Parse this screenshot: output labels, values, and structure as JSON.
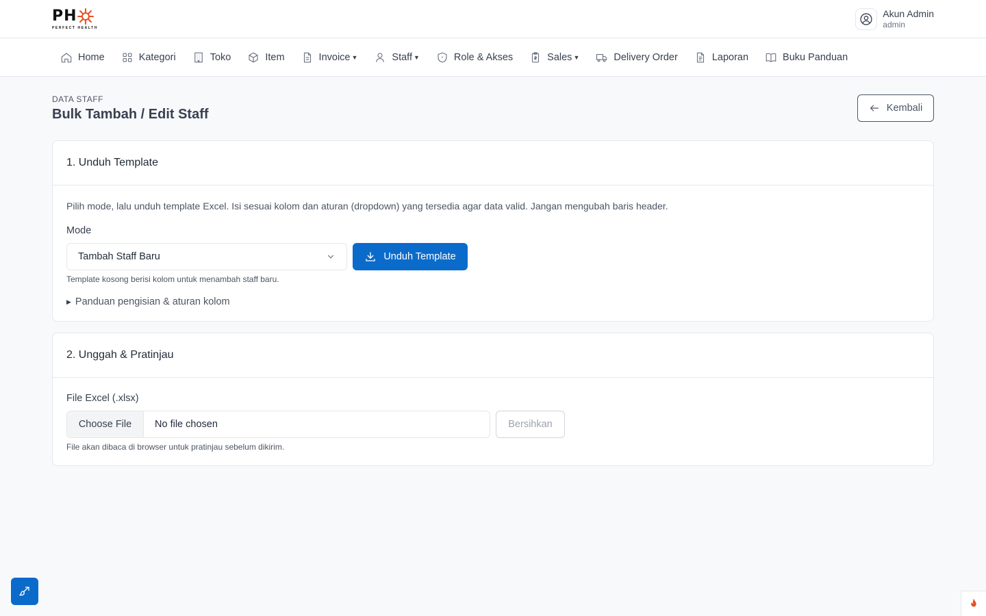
{
  "brand": {
    "logo_text": "PH",
    "tagline": "PERFECT HEALTH",
    "accent": "#e8501f"
  },
  "account": {
    "name": "Akun Admin",
    "role": "admin"
  },
  "nav": [
    {
      "label": "Home",
      "icon": "home-icon"
    },
    {
      "label": "Kategori",
      "icon": "grid-icon"
    },
    {
      "label": "Toko",
      "icon": "building-icon"
    },
    {
      "label": "Item",
      "icon": "box-icon"
    },
    {
      "label": "Invoice",
      "icon": "document-icon",
      "dropdown": true
    },
    {
      "label": "Staff",
      "icon": "user-icon",
      "dropdown": true
    },
    {
      "label": "Role & Akses",
      "icon": "shield-icon"
    },
    {
      "label": "Sales",
      "icon": "clipboard-icon",
      "dropdown": true
    },
    {
      "label": "Delivery Order",
      "icon": "truck-icon"
    },
    {
      "label": "Laporan",
      "icon": "report-icon"
    },
    {
      "label": "Buku Panduan",
      "icon": "book-icon"
    }
  ],
  "page": {
    "breadcrumb": "DATA STAFF",
    "title": "Bulk Tambah / Edit Staff",
    "back_label": "Kembali"
  },
  "step1": {
    "title": "1. Unduh Template",
    "description": "Pilih mode, lalu unduh template Excel. Isi sesuai kolom dan aturan (dropdown) yang tersedia agar data valid. Jangan mengubah baris header.",
    "mode_label": "Mode",
    "mode_value": "Tambah Staff Baru",
    "download_label": "Unduh Template",
    "hint": "Template kosong berisi kolom untuk menambah staff baru.",
    "guide_label": "Panduan pengisian & aturan kolom"
  },
  "step2": {
    "title": "2. Unggah & Pratinjau",
    "file_label": "File Excel (.xlsx)",
    "choose_label": "Choose File",
    "file_status": "No file chosen",
    "clear_label": "Bersihkan",
    "hint": "File akan dibaca di browser untuk pratinjau sebelum dikirim."
  },
  "colors": {
    "primary": "#0b6bcb",
    "border": "#e5e7eb",
    "background": "#f8f9fb"
  }
}
